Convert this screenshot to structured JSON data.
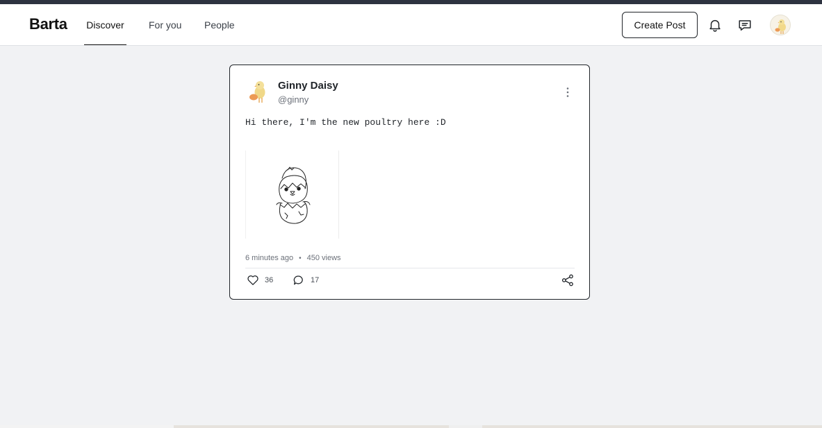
{
  "app": {
    "name": "Barta"
  },
  "nav": {
    "tabs": [
      {
        "label": "Discover",
        "active": true
      },
      {
        "label": "For you",
        "active": false
      },
      {
        "label": "People",
        "active": false
      }
    ],
    "create_post_label": "Create Post",
    "icons": [
      "bell-icon",
      "message-icon",
      "user-avatar"
    ]
  },
  "post": {
    "author_name": "Ginny Daisy",
    "author_handle": "@ginny",
    "text": "Hi there, I'm the new poultry here :D",
    "time_ago": "6 minutes ago",
    "views": "450 views",
    "likes": "36",
    "comments": "17"
  },
  "colors": {
    "top_strip": "#2d3340",
    "background": "#f1f2f4",
    "card_border": "#1f2328",
    "muted_text": "#6b7079"
  }
}
